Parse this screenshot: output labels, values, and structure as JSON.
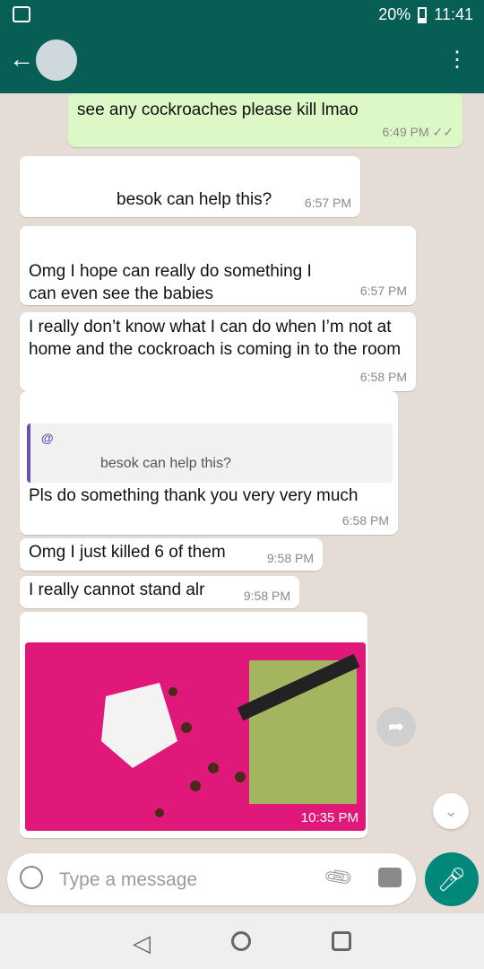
{
  "statusbar": {
    "battery": "20%",
    "time": "11:41"
  },
  "header": {
    "back_icon": "←",
    "title": "",
    "subtitle": "",
    "menu_icon": "⋮"
  },
  "messages": [
    {
      "type": "out",
      "text": "see any cockroaches please kill lmao",
      "time": "6:49 PM",
      "status_icon": "✓✓"
    },
    {
      "type": "in",
      "text": "besok can help this?",
      "time": "6:57 PM"
    },
    {
      "type": "in",
      "text": "Omg I hope can really do something I can even see the babies",
      "time": "6:57 PM"
    },
    {
      "type": "in",
      "text": "I really don’t know what I can do when I’m not at home and the cockroach is coming in to the room",
      "time": "6:58 PM"
    },
    {
      "type": "in",
      "quote_name": "@",
      "quote_text": "besok can help this?",
      "text": "Pls do something thank you very very much",
      "time": "6:58 PM"
    },
    {
      "type": "in",
      "text": "Omg I just killed 6 of them",
      "time": "9:58 PM"
    },
    {
      "type": "in",
      "text": "I really cannot stand alr",
      "time": "9:58 PM"
    },
    {
      "type": "in",
      "image_label": "photo",
      "time": "10:35 PM"
    }
  ],
  "input": {
    "placeholder": "Type a message"
  },
  "icons": [
    "back-icon",
    "menu-icon",
    "share-icon",
    "scroll-down-icon",
    "emoji-icon",
    "attach-icon",
    "camera-icon",
    "mic-icon"
  ]
}
